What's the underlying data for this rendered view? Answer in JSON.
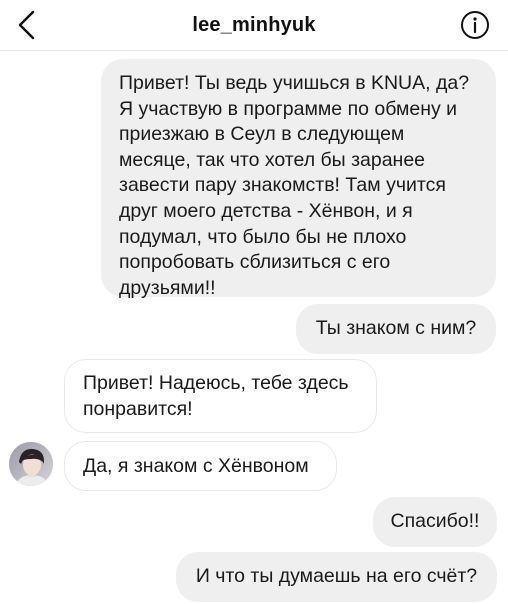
{
  "header": {
    "title": "lee_minhyuk",
    "back_icon": "chevron-left-icon",
    "info_icon": "info-circle-icon"
  },
  "messages": [
    {
      "side": "sent",
      "text": "Привет! Ты ведь учишься в KNUA, да?\nЯ участвую в программе по обмену и\nприезжаю в Сеул в следующем\nмесяце, так что хотел бы заранее\nзавести пару знакомств! Там учится\nдруг моего детства - Хёнвон, и я\nподумал, что было бы не плохо\nпопробовать сблизиться с его\nдрузьями!!"
    },
    {
      "side": "sent",
      "text": "Ты знаком с ним?"
    },
    {
      "side": "received",
      "text": "Привет! Надеюсь, тебе здесь\nпонравится!"
    },
    {
      "side": "received",
      "text": "Да, я знаком с Хёнвоном"
    },
    {
      "side": "sent",
      "text": "Спасибо!!"
    },
    {
      "side": "sent",
      "text": "И что ты думаешь на его счёт?"
    }
  ],
  "colors": {
    "sent_bubble": "#efefef",
    "received_border": "#e8e8e8",
    "text": "#1a1a1a"
  }
}
